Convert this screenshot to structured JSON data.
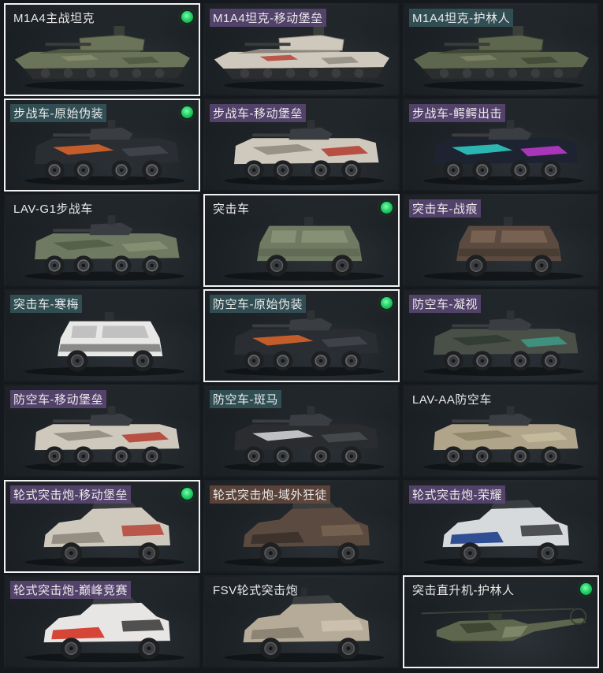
{
  "cards": [
    {
      "title": "M1A4主战坦克",
      "vehicle_type": "tank",
      "camo": "forest",
      "equipped": true,
      "selected": true,
      "rarity": "common"
    },
    {
      "title": "M1A4坦克-移动堡垒",
      "vehicle_type": "tank",
      "camo": "fortress",
      "equipped": false,
      "selected": false,
      "rarity": "epic"
    },
    {
      "title": "M1A4坦克-护林人",
      "vehicle_type": "tank",
      "camo": "woodland",
      "equipped": false,
      "selected": false,
      "rarity": "rare"
    },
    {
      "title": "步战车-原始伪装",
      "vehicle_type": "ifv",
      "camo": "orange",
      "equipped": true,
      "selected": true,
      "rarity": "rare"
    },
    {
      "title": "步战车-移动堡垒",
      "vehicle_type": "ifv",
      "camo": "fortress",
      "equipped": false,
      "selected": false,
      "rarity": "epic"
    },
    {
      "title": "步战车-鳄鳄出击",
      "vehicle_type": "ifv",
      "camo": "graffiti",
      "equipped": false,
      "selected": false,
      "rarity": "epic"
    },
    {
      "title": "LAV-G1步战车",
      "vehicle_type": "ifv",
      "camo": "green",
      "equipped": false,
      "selected": false,
      "rarity": "common"
    },
    {
      "title": "突击车",
      "vehicle_type": "mrap",
      "camo": "green",
      "equipped": true,
      "selected": true,
      "rarity": "common"
    },
    {
      "title": "突击车-战痕",
      "vehicle_type": "mrap",
      "camo": "rust",
      "equipped": false,
      "selected": false,
      "rarity": "epic"
    },
    {
      "title": "突击车-寒梅",
      "vehicle_type": "mrap",
      "camo": "snow",
      "equipped": false,
      "selected": false,
      "rarity": "rare"
    },
    {
      "title": "防空车-原始伪装",
      "vehicle_type": "ifv",
      "camo": "orange",
      "equipped": true,
      "selected": true,
      "rarity": "rare"
    },
    {
      "title": "防空车-凝视",
      "vehicle_type": "ifv",
      "camo": "teal",
      "equipped": false,
      "selected": false,
      "rarity": "epic"
    },
    {
      "title": "防空车-移动堡垒",
      "vehicle_type": "ifv",
      "camo": "fortress",
      "equipped": false,
      "selected": false,
      "rarity": "epic"
    },
    {
      "title": "防空车-斑马",
      "vehicle_type": "ifv",
      "camo": "zebra",
      "equipped": false,
      "selected": false,
      "rarity": "rare"
    },
    {
      "title": "LAV-AA防空车",
      "vehicle_type": "ifv",
      "camo": "desert",
      "equipped": false,
      "selected": false,
      "rarity": "common"
    },
    {
      "title": "轮式突击炮-移动堡垒",
      "vehicle_type": "armored_car",
      "camo": "fortress",
      "equipped": true,
      "selected": true,
      "rarity": "epic"
    },
    {
      "title": "轮式突击炮-域外狂徒",
      "vehicle_type": "armored_car",
      "camo": "rust",
      "equipped": false,
      "selected": false,
      "rarity": "legendary"
    },
    {
      "title": "轮式突击炮-荣耀",
      "vehicle_type": "armored_car",
      "camo": "blue",
      "equipped": false,
      "selected": false,
      "rarity": "epic"
    },
    {
      "title": "轮式突击炮-巅峰竞赛",
      "vehicle_type": "armored_car",
      "camo": "red",
      "equipped": false,
      "selected": false,
      "rarity": "epic"
    },
    {
      "title": "FSV轮式突击炮",
      "vehicle_type": "armored_car",
      "camo": "tan",
      "equipped": false,
      "selected": false,
      "rarity": "common"
    },
    {
      "title": "突击直升机-护林人",
      "vehicle_type": "helicopter",
      "camo": "woodland",
      "equipped": true,
      "selected": true,
      "rarity": "common"
    }
  ],
  "colors": {
    "background": "#15191d",
    "selected_border": "#f2f2f2",
    "equipped_badge": "#26d36a",
    "rarity_epic": "#5c4876",
    "rarity_rare": "#34565a",
    "rarity_legendary": "#64483c"
  }
}
